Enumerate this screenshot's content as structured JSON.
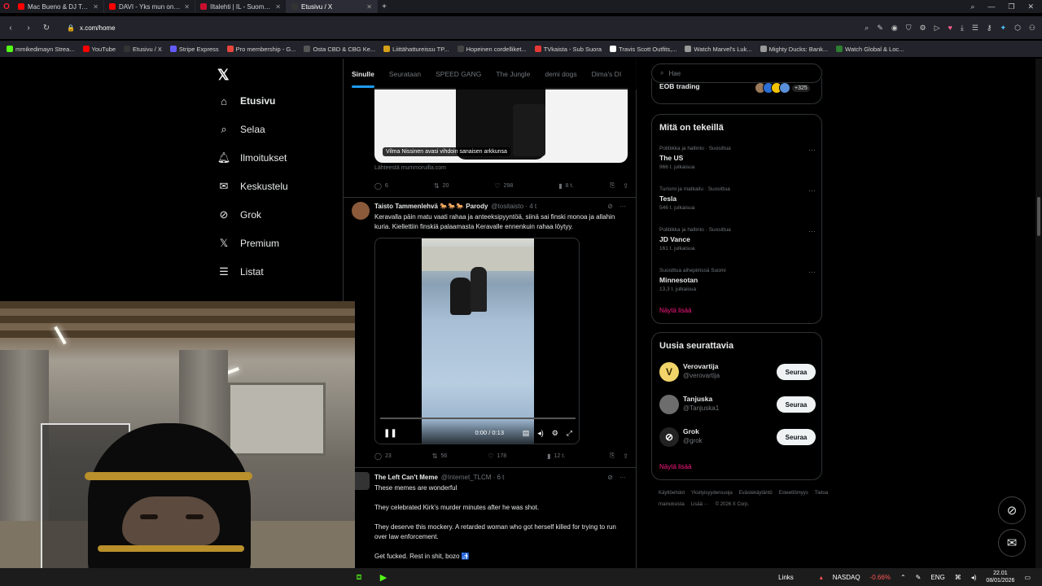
{
  "browser": {
    "tabs": [
      {
        "title": "Mac Bueno & DJ Tatc - No",
        "color": "#ff0000",
        "icon": "youtube-icon",
        "active": false
      },
      {
        "title": "DAVI - Yks mun ongelmii",
        "color": "#ff0000",
        "icon": "youtube-icon",
        "active": false
      },
      {
        "title": "Iltalehti | IL - Suomen suu",
        "color": "#c8102e",
        "icon": "iltalehti-icon",
        "active": false
      },
      {
        "title": "Etusivu / X",
        "color": "#333333",
        "icon": "x-icon",
        "active": true
      }
    ],
    "url": "x.com/home",
    "bookmarks": [
      {
        "label": "mmikedimayn Strea...",
        "color": "#53fc18"
      },
      {
        "label": "YouTube",
        "color": "#ff0000"
      },
      {
        "label": "Etusivu / X",
        "color": "#333333"
      },
      {
        "label": "Stripe Express",
        "color": "#635bff"
      },
      {
        "label": "Pro membership - G...",
        "color": "#e8453c"
      },
      {
        "label": "Osta CBD & CBG Ke...",
        "color": "#555555"
      },
      {
        "label": "Liittähattureissu TP...",
        "color": "#d4a017"
      },
      {
        "label": "Hopeinen cordelliket...",
        "color": "#444444"
      },
      {
        "label": "TVkaista - Sub Suora",
        "color": "#e53935"
      },
      {
        "label": "Travis Scott Outfits,...",
        "color": "#ffffff"
      },
      {
        "label": "Watch Marvel's Luk...",
        "color": "#999999"
      },
      {
        "label": "Mighty Ducks: Bank...",
        "color": "#999999"
      },
      {
        "label": "Watch Global & Loc...",
        "color": "#2e7d32"
      }
    ]
  },
  "nav": {
    "items": [
      {
        "label": "Etusivu",
        "icon": "home-icon",
        "bold": true
      },
      {
        "label": "Selaa",
        "icon": "search-icon",
        "bold": false
      },
      {
        "label": "Ilmoitukset",
        "icon": "bell-icon",
        "bold": false
      },
      {
        "label": "Keskustelu",
        "icon": "mail-icon",
        "bold": false
      },
      {
        "label": "Grok",
        "icon": "grok-icon",
        "bold": false
      },
      {
        "label": "Premium",
        "icon": "x-premium-icon",
        "bold": false
      },
      {
        "label": "Listat",
        "icon": "list-icon",
        "bold": false
      }
    ]
  },
  "feed": {
    "tabs": [
      "Sinulle",
      "Seurataan",
      "SPEED GANG",
      "The Jungle",
      "demi dogs",
      "Dima's DI"
    ],
    "post1": {
      "caption": "Vilma Nissinen avasi vihdoin sanaisen arkkunsa",
      "source": "Lähteestä mummoruilla.com",
      "replies": "6",
      "reposts": "20",
      "likes": "298",
      "views": "8 t."
    },
    "post2": {
      "name": "Taisto Tammenlehvä 🐎🐎🐎 Parody",
      "handle": "@tositaisto · 4 t",
      "text": "Keravalla päin matu vaati rahaa ja anteeksipyyntöä, siinä sai finski monoa ja allahin kuria. Kiellettiin finskiä palaamasta Keravalle ennenkuin rahaa löytyy.",
      "video_time": "0:00 / 0:13",
      "video_progress": 0.0,
      "replies": "23",
      "reposts": "56",
      "likes": "178",
      "views": "12 t."
    },
    "post3": {
      "name": "The Left Can't Meme",
      "handle": "@Internet_TLCM · 6 t",
      "lines": [
        "These memes are wonderful",
        "They celebrated Kirk's murder minutes after he was shot.",
        "They deserve this mockery. A retarded woman who got herself killed for trying to run over law enforcement.",
        "Get fucked. Rest in shit, bozo 🚮"
      ]
    }
  },
  "sidebar": {
    "search_placeholder": "Hae",
    "eob_label": "EOB trading",
    "eob_count": "+325",
    "trending_title": "Mitä on tekeillä",
    "trends": [
      {
        "category": "Politiikka ja hallinto · Suosittua",
        "title": "The US",
        "count": "966 t. julkaisua"
      },
      {
        "category": "Turismi ja matkailu · Suosittua",
        "title": "Tesla",
        "count": "546 t. julkaisua"
      },
      {
        "category": "Politiikka ja hallinto · Suosittua",
        "title": "JD Vance",
        "count": "161 t. julkaisua"
      },
      {
        "category": "Suosittua aihepiirissä Suomi",
        "title": "Minnesotan",
        "count": "13,3 t. julkaisua"
      }
    ],
    "show_more": "Näytä lisää",
    "who_title": "Uusia seurattavia",
    "who": [
      {
        "name": "Verovartija",
        "handle": "@verovartija",
        "avatar_color": "#f1d46a",
        "avatar_letter": "V"
      },
      {
        "name": "Tanjuska",
        "handle": "@Tanjuska1",
        "avatar_color": "#6d6d6d",
        "avatar_letter": ""
      },
      {
        "name": "Grok",
        "handle": "@grok",
        "avatar_color": "#222222",
        "avatar_letter": "⊘"
      }
    ],
    "follow_label": "Seuraa",
    "footer": [
      "Käyttöehdot",
      "Yksityisyydensuoja",
      "Evästekäytäntö",
      "Esteettömyys",
      "Tietoa mainoksista",
      "Lisää ···",
      "© 2026 X Corp."
    ]
  },
  "taskbar": {
    "links": "Links",
    "ticker": "NASDAQ",
    "ticker_change": "-0.66%",
    "lang": "ENG",
    "time": "22.01",
    "date": "08/01/2026"
  }
}
